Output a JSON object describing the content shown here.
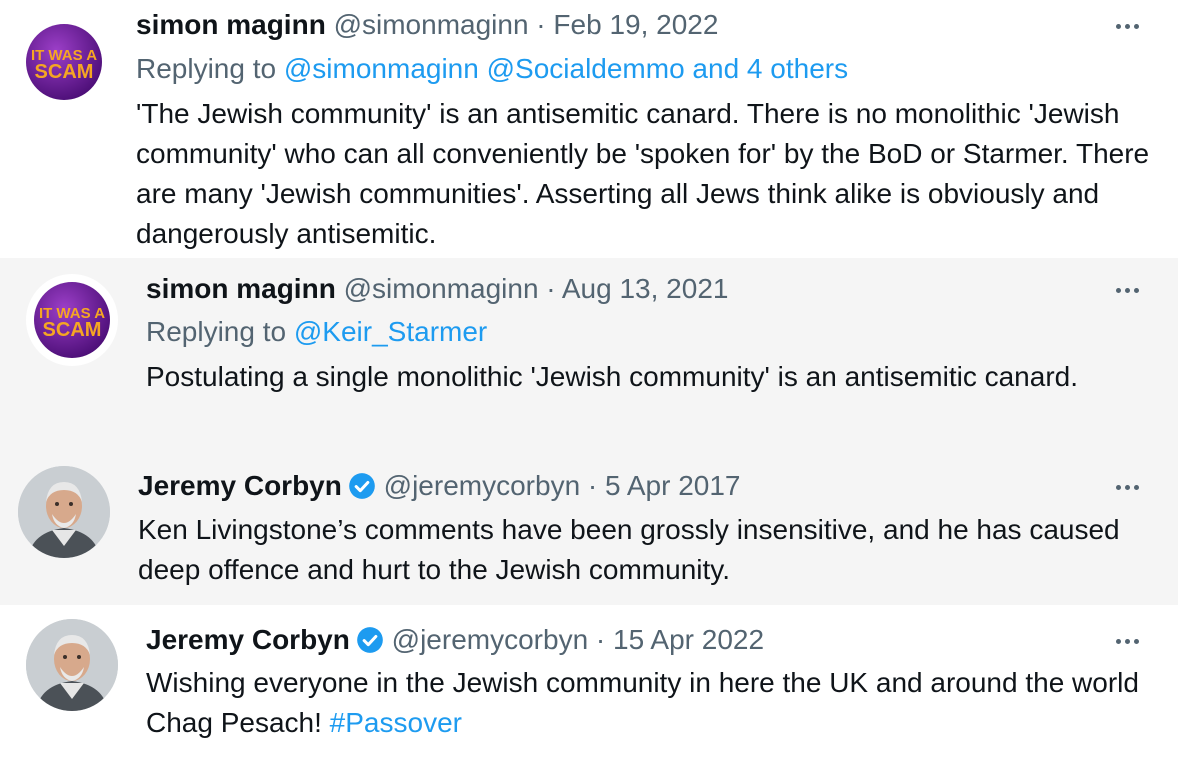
{
  "tweets": [
    {
      "avatar": "it-was-a-scam-badge",
      "avatar_text": [
        "IT WAS A",
        "SCAM"
      ],
      "name": "simon maginn",
      "handle": "@simonmaginn",
      "date": "Feb 19, 2022",
      "replying_prefix": "Replying to",
      "replying_to": "@simonmaginn @Socialdemmo and 4 others",
      "text": "'The Jewish community' is an antisemitic canard. There is no monolithic 'Jewish community' who can all conveniently be 'spoken for' by the BoD or Starmer. There are many 'Jewish communities'. Asserting all Jews think alike is obviously and dangerously antisemitic."
    },
    {
      "avatar": "it-was-a-scam-badge",
      "avatar_text": [
        "IT WAS A",
        "SCAM"
      ],
      "name": "simon maginn",
      "handle": "@simonmaginn",
      "date": "Aug 13, 2021",
      "replying_prefix": "Replying to",
      "replying_to": "@Keir_Starmer",
      "text": "Postulating a single monolithic 'Jewish community' is an antisemitic canard."
    },
    {
      "avatar": "corbyn-portrait",
      "name": "Jeremy Corbyn",
      "verified": true,
      "handle": "@jeremycorbyn",
      "date": "5 Apr 2017",
      "text": "Ken Livingstone’s comments have been grossly insensitive, and he has caused deep offence and hurt to the Jewish community."
    },
    {
      "avatar": "corbyn-portrait",
      "name": "Jeremy Corbyn",
      "verified": true,
      "handle": "@jeremycorbyn",
      "date": "15 Apr 2022",
      "text_before_hashtag": "Wishing everyone in the Jewish community in here the UK and around the world Chag Pesach!",
      "hashtag": "#Passover"
    }
  ],
  "separator": " · ",
  "icons": {
    "more": "more-dots-icon",
    "verified": "verified-badge-icon"
  },
  "colors": {
    "link": "#1d9bf0",
    "verified": "#1d9bf0",
    "text": "#0f1419",
    "meta": "#536471",
    "badge": "#6a1b9a",
    "badge_text": "#f5a623"
  }
}
